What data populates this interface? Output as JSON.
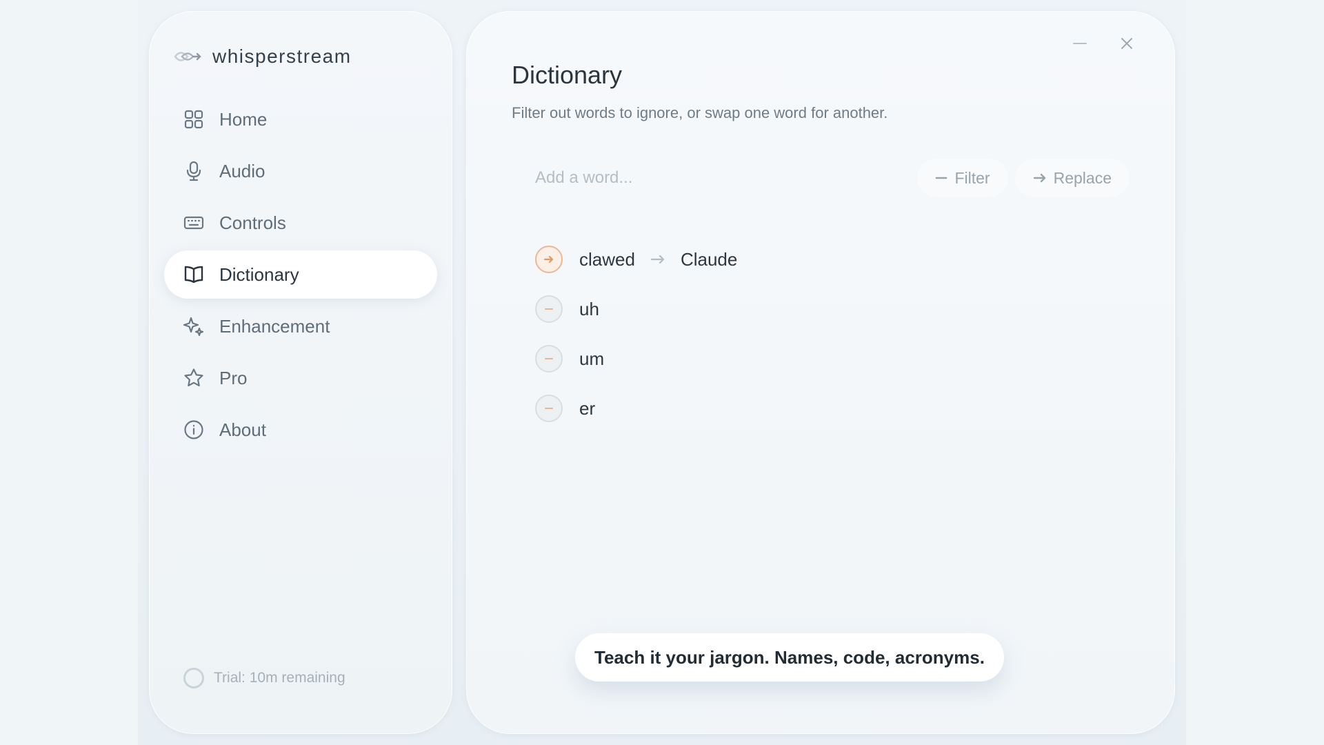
{
  "app": {
    "name": "whisperstream"
  },
  "sidebar": {
    "items": [
      {
        "label": "Home",
        "icon": "grid-icon",
        "active": false
      },
      {
        "label": "Audio",
        "icon": "microphone-icon",
        "active": false
      },
      {
        "label": "Controls",
        "icon": "keyboard-icon",
        "active": false
      },
      {
        "label": "Dictionary",
        "icon": "book-icon",
        "active": true
      },
      {
        "label": "Enhancement",
        "icon": "sparkle-icon",
        "active": false
      },
      {
        "label": "Pro",
        "icon": "star-icon",
        "active": false
      },
      {
        "label": "About",
        "icon": "info-icon",
        "active": false
      }
    ],
    "trial_text": "Trial: 10m remaining"
  },
  "main": {
    "title": "Dictionary",
    "subtitle": "Filter out words to ignore, or swap one word for another.",
    "add_placeholder": "Add a word...",
    "filter_label": "Filter",
    "replace_label": "Replace",
    "entries": [
      {
        "type": "replace",
        "word": "clawed",
        "replacement": "Claude"
      },
      {
        "type": "filter",
        "word": "uh"
      },
      {
        "type": "filter",
        "word": "um"
      },
      {
        "type": "filter",
        "word": "er"
      }
    ],
    "tip": "Teach it your jargon. Names, code, acronyms."
  },
  "colors": {
    "accent": "#e8a578",
    "text_primary": "#2a3540",
    "text_secondary": "#6f7c86",
    "active_item_bg": "#ffffff"
  }
}
